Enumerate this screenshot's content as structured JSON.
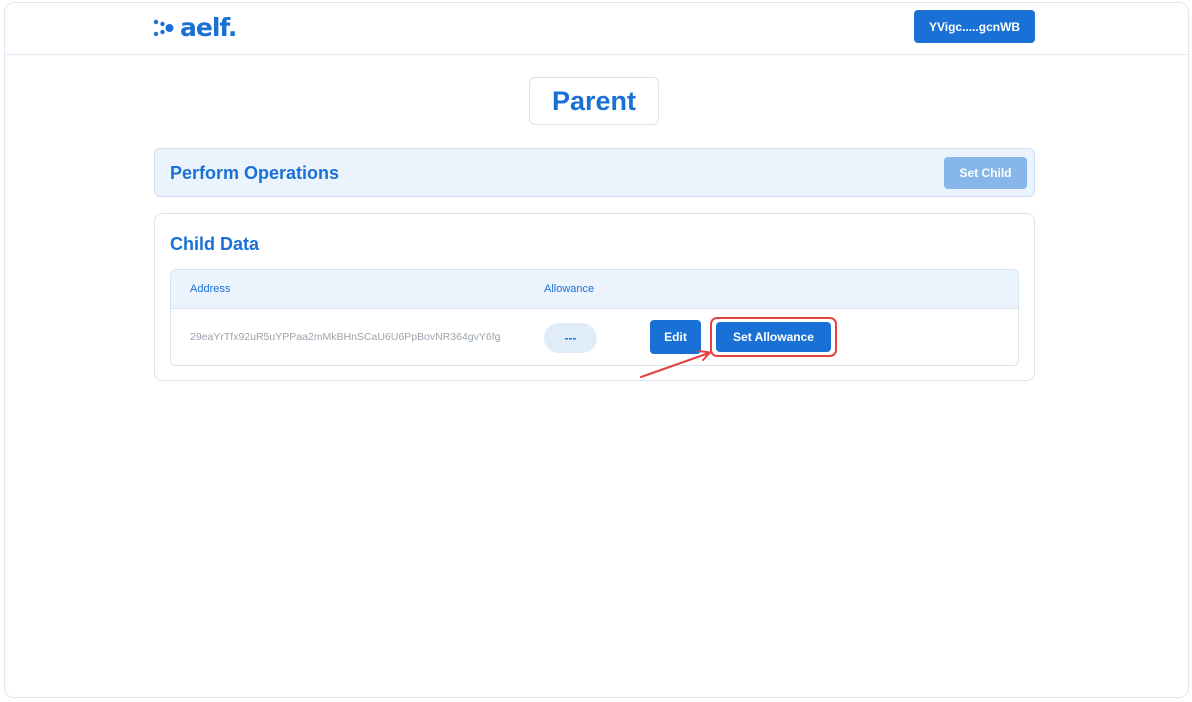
{
  "header": {
    "logo_text": "aelf.",
    "wallet_label": "YVigc.....gcnWB"
  },
  "page": {
    "title": "Parent"
  },
  "operations": {
    "title": "Perform Operations",
    "set_child_label": "Set Child"
  },
  "child_data": {
    "title": "Child Data",
    "columns": [
      "Address",
      "Allowance"
    ],
    "rows": [
      {
        "address": "29eaYrTfx92uR5uYPPaa2mMkBHnSCaU6U6PpBovNR364gvY6fg",
        "allowance": "---",
        "edit_label": "Edit",
        "set_allowance_label": "Set Allowance"
      }
    ]
  },
  "colors": {
    "brand": "#1971d6",
    "highlight": "#e4413f"
  },
  "icons": {
    "logo": "aelf-dots-icon",
    "annotation": "red-arrow-icon"
  }
}
